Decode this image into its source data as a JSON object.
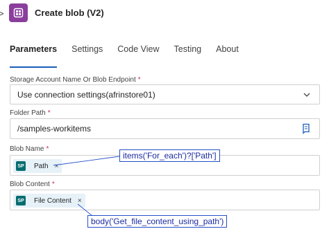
{
  "header": {
    "title": "Create blob (V2)",
    "back_glyph": ">",
    "app_icon": "blob-storage-icon",
    "app_icon_color": "#8a3f9c"
  },
  "tabs": [
    {
      "label": "Parameters",
      "active": true
    },
    {
      "label": "Settings",
      "active": false
    },
    {
      "label": "Code View",
      "active": false
    },
    {
      "label": "Testing",
      "active": false
    },
    {
      "label": "About",
      "active": false
    }
  ],
  "fields": {
    "storage_account": {
      "label": "Storage Account Name Or Blob Endpoint",
      "required": "*",
      "value": "Use connection settings(afrinstore01)"
    },
    "folder_path": {
      "label": "Folder Path",
      "required": "*",
      "value": "/samples-workitems"
    },
    "blob_name": {
      "label": "Blob Name",
      "required": "*",
      "token": {
        "icon_text": "SP",
        "label": "Path",
        "remove": "×"
      }
    },
    "blob_content": {
      "label": "Blob Content",
      "required": "*",
      "token": {
        "icon_text": "SP",
        "label": "File Content",
        "remove": "×"
      }
    }
  },
  "annotations": {
    "blob_name_expression": "items('For_each')?['Path']",
    "blob_content_expression": "body('Get_file_content_using_path')"
  },
  "colors": {
    "accent": "#1b5cb8",
    "required": "#c4314b",
    "token_bg": "#e6f1f8",
    "callout_border": "#2450c8"
  }
}
